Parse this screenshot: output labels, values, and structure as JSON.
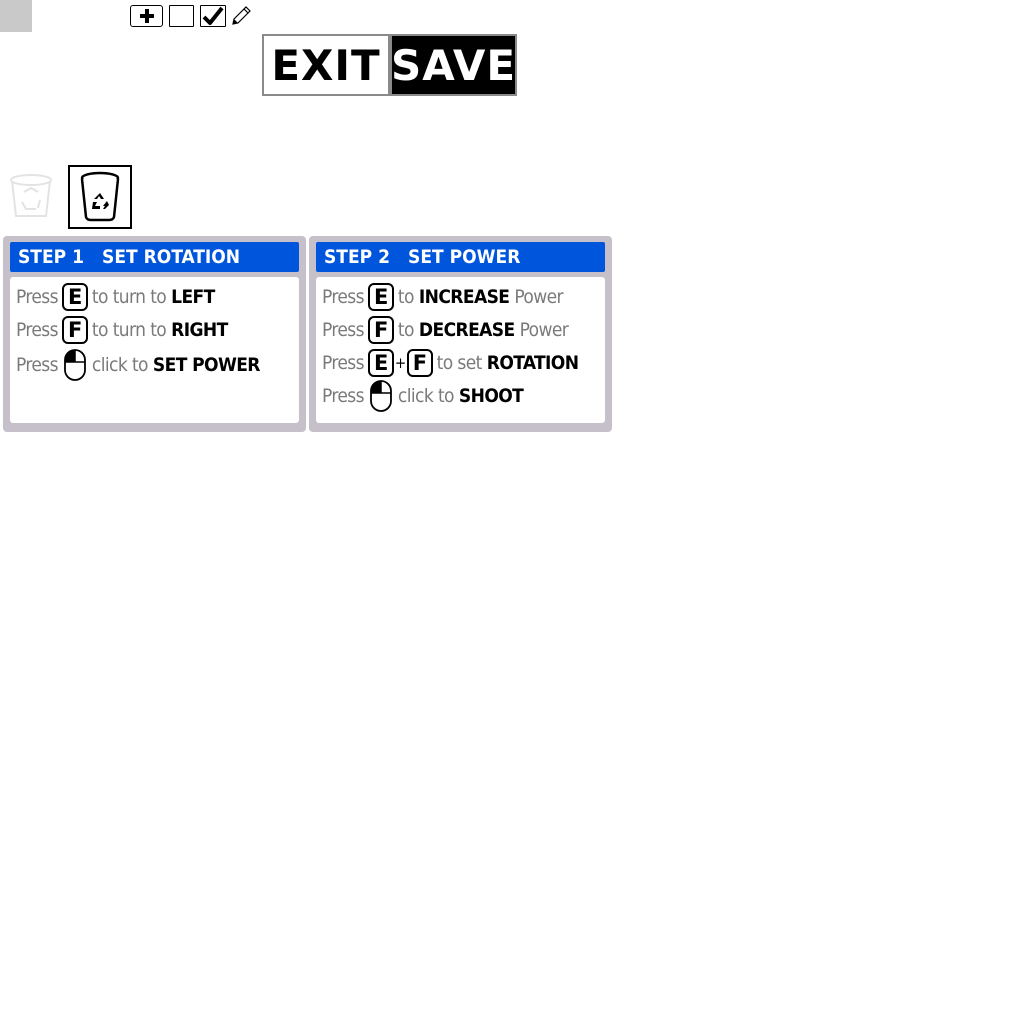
{
  "toolbar": {
    "icons": [
      "add-icon",
      "blank-icon",
      "checkmark-icon",
      "pencil-icon"
    ]
  },
  "buttons": {
    "exit_label": "EXIT",
    "save_label": "SAVE"
  },
  "colors": {
    "panel_bg": "#c5c0c9",
    "header_blue": "#0055dd",
    "text_gray": "#7a7a7a"
  },
  "steps": [
    {
      "step_label": "STEP 1",
      "title": "SET ROTATION",
      "lines": [
        {
          "prefix": "Press",
          "key": "E",
          "middle": "to turn to",
          "action": "LEFT",
          "suffix": ""
        },
        {
          "prefix": "Press",
          "key": "F",
          "middle": "to turn to",
          "action": "RIGHT",
          "suffix": ""
        },
        {
          "prefix": "Press",
          "middle": "click to",
          "action": "SET POWER",
          "suffix": ""
        }
      ]
    },
    {
      "step_label": "STEP 2",
      "title": "SET POWER",
      "lines": [
        {
          "prefix": "Press",
          "key": "E",
          "middle": "to",
          "action": "INCREASE",
          "suffix": "Power"
        },
        {
          "prefix": "Press",
          "key": "F",
          "middle": "to",
          "action": "DECREASE",
          "suffix": "Power"
        },
        {
          "prefix": "Press",
          "key": "E",
          "key2": "F",
          "plus": "+",
          "middle": "to set",
          "action": "ROTATION",
          "suffix": ""
        },
        {
          "prefix": "Press",
          "middle": "click to",
          "action": "SHOOT",
          "suffix": ""
        }
      ]
    }
  ]
}
